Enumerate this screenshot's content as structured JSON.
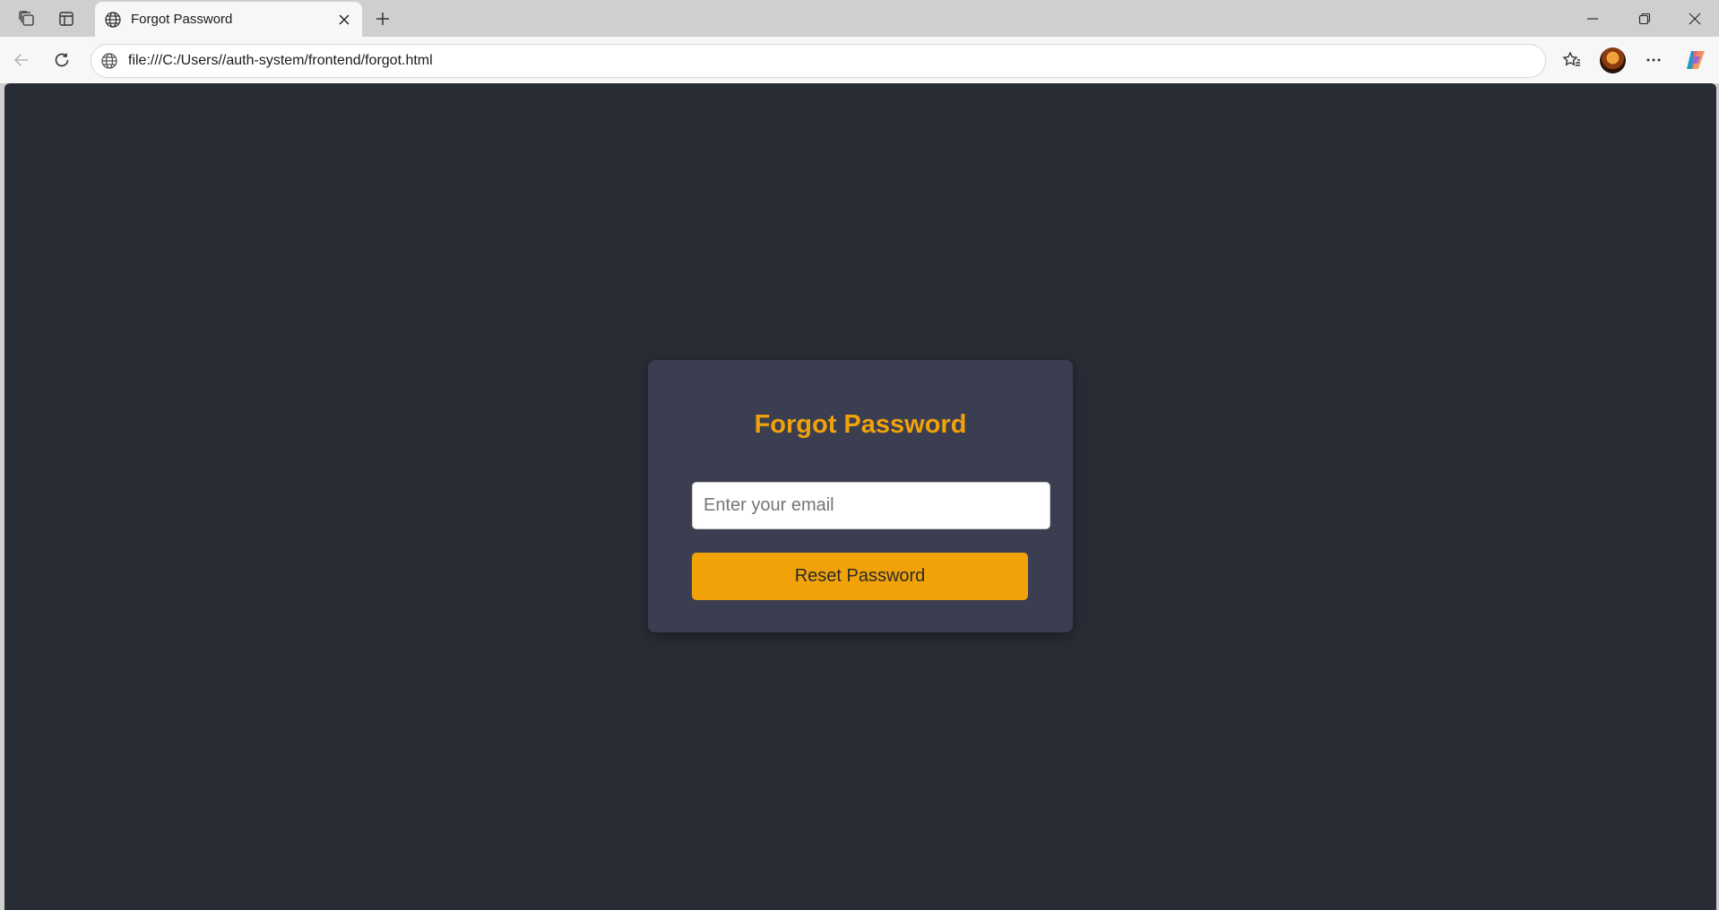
{
  "browser": {
    "tab": {
      "title": "Forgot Password",
      "favicon": "globe-icon"
    },
    "address": {
      "url": "file:///C:/Users//auth-system/frontend/forgot.html",
      "site_icon": "globe-icon"
    },
    "icons": {
      "workspaces": "workspaces-icon",
      "tab_actions": "vertical-tabs-icon",
      "new_tab": "plus-icon",
      "back": "back-arrow-icon",
      "refresh": "refresh-icon",
      "favorites": "favorites-star-icon",
      "more": "more-dots-icon",
      "copilot": "copilot-icon",
      "minimize": "minimize-icon",
      "restore": "restore-icon",
      "close": "close-icon"
    }
  },
  "page": {
    "background": "#282c35",
    "card_background": "#3b3e51",
    "accent": "#f1a208",
    "title": "Forgot Password",
    "email": {
      "placeholder": "Enter your email",
      "value": ""
    },
    "reset_button_label": "Reset Password"
  }
}
